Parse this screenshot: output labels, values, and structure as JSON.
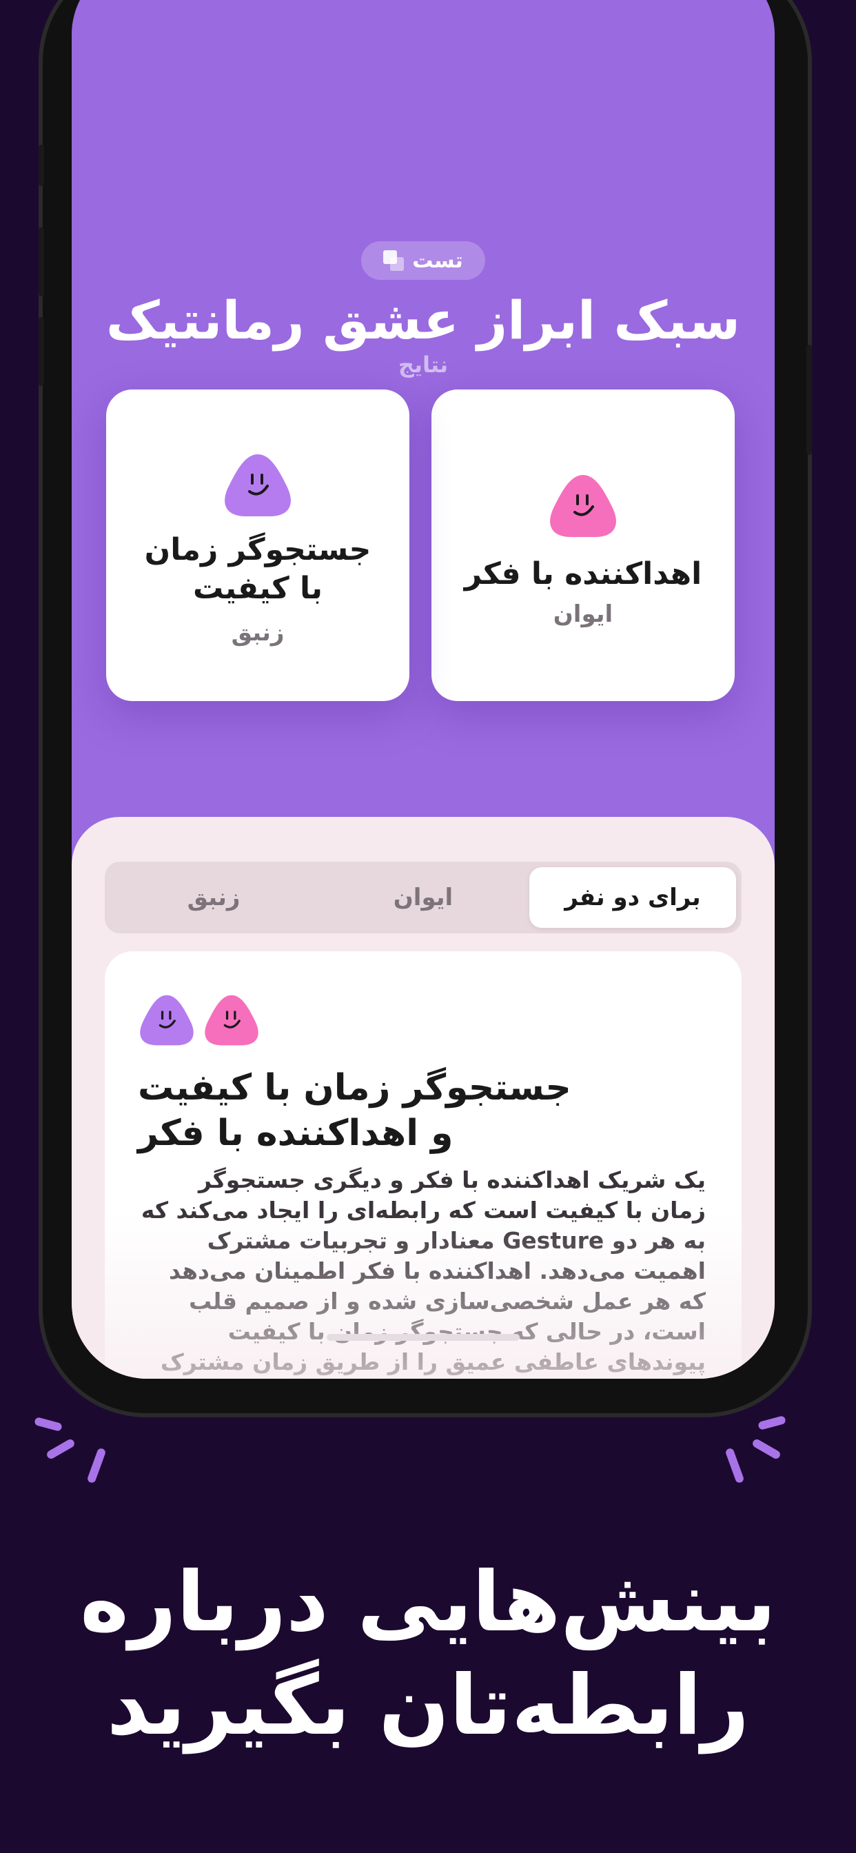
{
  "badge": {
    "label": "تست"
  },
  "header": {
    "title": "سبک ابراز عشق رمانتیک",
    "subtitle": "نتایج"
  },
  "cards": [
    {
      "name": "اهداکننده با فکر",
      "user": "ایوان",
      "color": "#f56fbc"
    },
    {
      "name": "جستجوگر زمان با کیفیت",
      "user": "زنبق",
      "color": "#b57cf0"
    }
  ],
  "tabs": [
    {
      "label": "برای دو نفر",
      "active": true
    },
    {
      "label": "ایوان",
      "active": false
    },
    {
      "label": "زنبق",
      "active": false
    }
  ],
  "detail": {
    "title": "جستجوگر زمان با کیفیت و اهداکننده با فکر",
    "body": "یک شریک اهداکننده با فکر و دیگری جستجوگر زمان با کیفیت است که رابطه‌ای را ایجاد می‌کند که به هر دو Gesture معنادار و تجربیات مشترک اهمیت می‌دهد. اهداکننده با فکر اطمینان می‌دهد که هر عمل شخصی‌سازی شده و از صمیم قلب است، در حالی که جستجوگر زمان با کیفیت پیوندهای عاطفی عمیق را از طریق زمان مشترک"
  },
  "headline": "بینش‌هایی درباره رابطه‌تان بگیرید",
  "colors": {
    "background": "#1c0930",
    "screen": "#9a6ae0",
    "accent": "#a873e8"
  }
}
